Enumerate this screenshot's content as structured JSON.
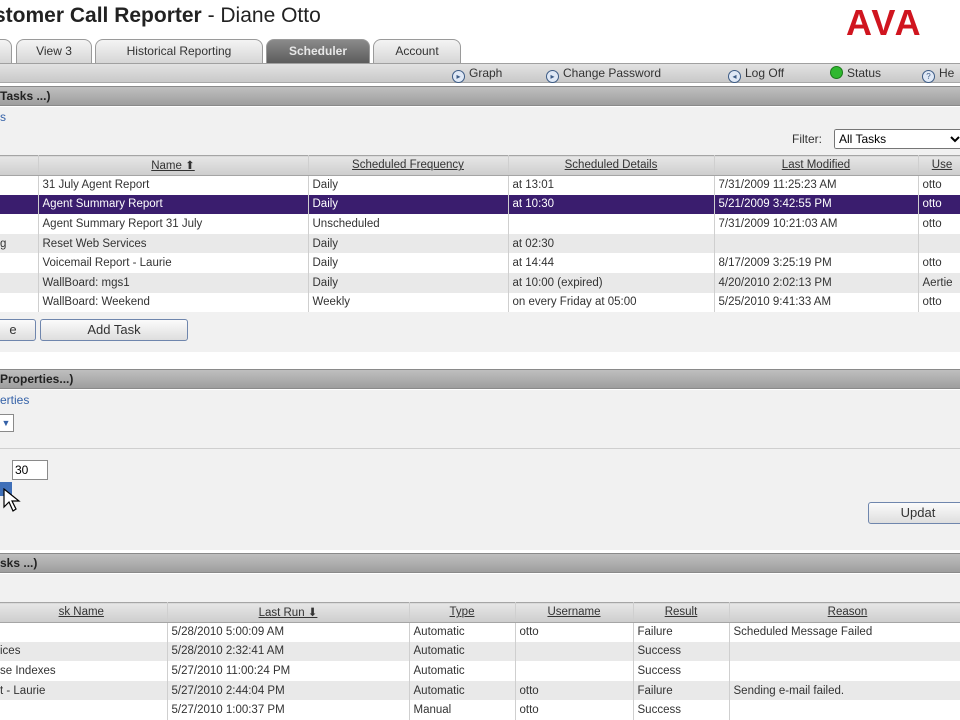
{
  "app": {
    "title_bold": "stomer Call Reporter",
    "title_rest": " - Diane Otto",
    "logo": "AVA"
  },
  "tabs": [
    {
      "label": ""
    },
    {
      "label": "View 3"
    },
    {
      "label": "Historical Reporting"
    },
    {
      "label": "Scheduler"
    },
    {
      "label": "Account"
    }
  ],
  "util": {
    "graph": "Graph",
    "change_password": "Change Password",
    "logoff": "Log Off",
    "status": "Status",
    "help": "He"
  },
  "tasks": {
    "header": "Tasks ...)",
    "link": "s",
    "filter_label": "Filter:",
    "filter_value": "All Tasks",
    "columns": [
      "",
      "Name ⬆",
      "Scheduled Frequency",
      "Scheduled Details",
      "Last Modified",
      "Use"
    ],
    "rows": [
      [
        "",
        "31 July Agent Report",
        "Daily",
        "at 13:01",
        "7/31/2009 11:25:23 AM",
        "otto"
      ],
      [
        "",
        "Agent Summary Report",
        "Daily",
        "at 10:30",
        "5/21/2009 3:42:55 PM",
        "otto"
      ],
      [
        "",
        "Agent Summary Report 31 July",
        "Unscheduled",
        "",
        "7/31/2009 10:21:03 AM",
        "otto"
      ],
      [
        "g",
        "Reset Web Services",
        "Daily",
        "at 02:30",
        "",
        ""
      ],
      [
        "",
        "Voicemail Report - Laurie",
        "Daily",
        "at 14:44",
        "8/17/2009 3:25:19 PM",
        "otto"
      ],
      [
        "",
        "WallBoard: mgs1",
        "Daily",
        "at 10:00 (expired)",
        "4/20/2010 2:02:13 PM",
        "Aertie"
      ],
      [
        "",
        "WallBoard: Weekend",
        "Weekly",
        "on every Friday at 05:00",
        "5/25/2010 9:41:33 AM",
        "otto"
      ]
    ],
    "btn_left": "e",
    "btn_add": "Add Task"
  },
  "properties": {
    "header": "Properties...)",
    "link": "erties",
    "time_value": "30",
    "update_label": "Updat"
  },
  "history": {
    "header": "sks ...)",
    "columns": [
      "sk Name",
      "Last Run ⬇",
      "Type",
      "Username",
      "Result",
      "Reason"
    ],
    "rows": [
      [
        "",
        "5/28/2010 5:00:09 AM",
        "Automatic",
        "otto",
        "Failure",
        "Scheduled Message Failed"
      ],
      [
        "ices",
        "5/28/2010 2:32:41 AM",
        "Automatic",
        "",
        "Success",
        ""
      ],
      [
        "se Indexes",
        "5/27/2010 11:00:24 PM",
        "Automatic",
        "",
        "Success",
        ""
      ],
      [
        "t - Laurie",
        "5/27/2010 2:44:04 PM",
        "Automatic",
        "otto",
        "Failure",
        "Sending e-mail failed."
      ],
      [
        "",
        "5/27/2010 1:00:37 PM",
        "Manual",
        "otto",
        "Success",
        ""
      ]
    ]
  },
  "colors": {
    "accent": "#3a1d6e",
    "logo": "#d0151f",
    "link": "#3562a8"
  }
}
